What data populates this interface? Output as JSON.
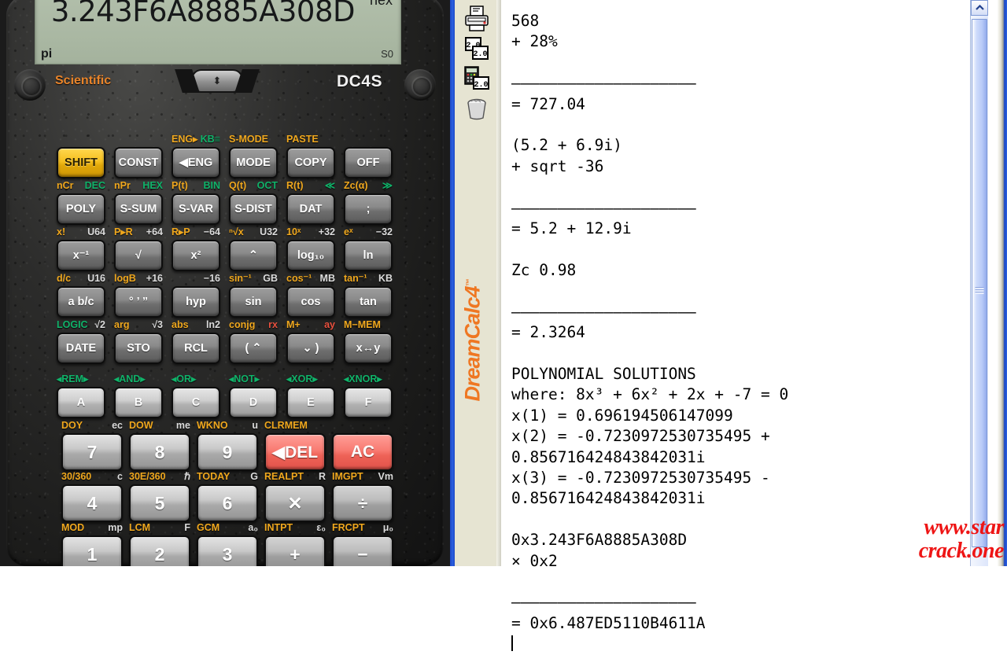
{
  "app": {
    "brand": "DreamCalc",
    "brand_version": "4",
    "brand_tm": "™"
  },
  "display": {
    "value": "3.243F6A8885A308D",
    "base_indicator": "hex",
    "angle_indicator": "pi",
    "memory_indicator": "S0",
    "mode_label": "Scientific",
    "model_label": "DC4S",
    "rocker_glyph": "⬍"
  },
  "keys": {
    "rows": [
      {
        "cells": [
          {
            "top_left": "",
            "top_right": "",
            "face": "SHIFT",
            "style": "shift",
            "name": "shift"
          },
          {
            "top_left": "",
            "top_right": "",
            "face": "CONST",
            "style": "",
            "name": "const"
          },
          {
            "top_left": "ENG▸",
            "tl_color": "y",
            "top_right": "KB≡",
            "tr_color": "g",
            "face": "◀ENG",
            "style": "",
            "name": "eng"
          },
          {
            "top_left": "S-MODE",
            "tl_color": "y",
            "top_right": "",
            "face": "MODE",
            "style": "",
            "name": "mode"
          },
          {
            "top_left": "PASTE",
            "tl_color": "y",
            "top_right": "",
            "face": "COPY",
            "style": "",
            "name": "copy"
          },
          {
            "top_left": "",
            "top_right": "",
            "face": "OFF",
            "style": "",
            "name": "off"
          }
        ]
      },
      {
        "cells": [
          {
            "top_left": "nCr",
            "tl_color": "y",
            "top_right": "DEC",
            "tr_color": "g",
            "face": "POLY",
            "style": "",
            "name": "poly"
          },
          {
            "top_left": "nPr",
            "tl_color": "y",
            "top_right": "HEX",
            "tr_color": "g",
            "face": "S-SUM",
            "style": "",
            "name": "s-sum"
          },
          {
            "top_left": "P(t)",
            "tl_color": "y",
            "top_right": "BIN",
            "tr_color": "g",
            "face": "S-VAR",
            "style": "",
            "name": "s-var"
          },
          {
            "top_left": "Q(t)",
            "tl_color": "y",
            "top_right": "OCT",
            "tr_color": "g",
            "face": "S-DIST",
            "style": "",
            "name": "s-dist"
          },
          {
            "top_left": "R(t)",
            "tl_color": "y",
            "top_right": "≪",
            "tr_color": "g",
            "face": "DAT",
            "style": "",
            "name": "dat"
          },
          {
            "top_left": "Zc(α)",
            "tl_color": "y",
            "top_right": "≫",
            "tr_color": "g",
            "face": ";",
            "style": "",
            "name": "semicolon"
          }
        ]
      },
      {
        "cells": [
          {
            "top_left": "x!",
            "tl_color": "y",
            "top_right": "U64",
            "tr_color": "w",
            "face": "x⁻¹",
            "style": "",
            "name": "reciprocal"
          },
          {
            "top_left": "P▸R",
            "tl_color": "y",
            "top_right": "+64",
            "tr_color": "w",
            "face": "√",
            "style": "",
            "name": "sqrt"
          },
          {
            "top_left": "R▸P",
            "tl_color": "y",
            "top_right": "−64",
            "tr_color": "w",
            "face": "x²",
            "style": "",
            "name": "square"
          },
          {
            "top_left": "ⁿ√x",
            "tl_color": "y",
            "top_right": "U32",
            "tr_color": "w",
            "face": "⌃",
            "style": "",
            "name": "power"
          },
          {
            "top_left": "10ˣ",
            "tl_color": "y",
            "top_right": "+32",
            "tr_color": "w",
            "face": "log₁₀",
            "style": "",
            "name": "log10"
          },
          {
            "top_left": "eˣ",
            "tl_color": "y",
            "top_right": "−32",
            "tr_color": "w",
            "face": "ln",
            "style": "",
            "name": "ln"
          }
        ]
      },
      {
        "cells": [
          {
            "top_left": "d/c",
            "tl_color": "y",
            "top_right": "U16",
            "tr_color": "w",
            "face": "a b/c",
            "style": "",
            "name": "fraction"
          },
          {
            "top_left": "logB",
            "tl_color": "y",
            "top_right": "+16",
            "tr_color": "w",
            "face": "° ’ ”",
            "style": "",
            "name": "dms"
          },
          {
            "top_left": "",
            "top_right": "−16",
            "tr_color": "w",
            "face": "hyp",
            "style": "",
            "name": "hyp"
          },
          {
            "top_left": "sin⁻¹",
            "tl_color": "y",
            "top_right": "GB",
            "tr_color": "w",
            "face": "sin",
            "style": "",
            "name": "sin"
          },
          {
            "top_left": "cos⁻¹",
            "tl_color": "y",
            "top_right": "MB",
            "tr_color": "w",
            "face": "cos",
            "style": "",
            "name": "cos"
          },
          {
            "top_left": "tan⁻¹",
            "tl_color": "y",
            "top_right": "KB",
            "tr_color": "w",
            "face": "tan",
            "style": "",
            "name": "tan"
          }
        ]
      },
      {
        "cells": [
          {
            "top_left": "LOGIC",
            "tl_color": "g",
            "top_right": "√2",
            "tr_color": "w",
            "face": "DATE",
            "style": "",
            "name": "date"
          },
          {
            "top_left": "arg",
            "tl_color": "y",
            "top_right": "√3",
            "tr_color": "w",
            "face": "STO",
            "style": "",
            "name": "sto"
          },
          {
            "top_left": "abs",
            "tl_color": "y",
            "top_right": "ln2",
            "tr_color": "w",
            "face": "RCL",
            "style": "",
            "name": "rcl"
          },
          {
            "top_left": "conjg",
            "tl_color": "y",
            "top_right": "rx",
            "tr_color": "rd",
            "face": "( ⌃",
            "style": "",
            "name": "paren-open"
          },
          {
            "top_left": "M+",
            "tl_color": "y",
            "top_right": "ay",
            "tr_color": "rd",
            "face": "⌄ )",
            "style": "",
            "name": "paren-close"
          },
          {
            "top_left": "M−MEM",
            "tl_color": "y",
            "tr_color": "rd",
            "top_right": "",
            "face": "x↔y",
            "style": "",
            "name": "swap-xy"
          }
        ]
      },
      {
        "cells": [
          {
            "top_left": "◂REM▸",
            "tl_color": "g",
            "top_right": "",
            "face": "A",
            "style": "hexk",
            "name": "hex-a"
          },
          {
            "top_left": "◂AND▸",
            "tl_color": "g",
            "top_right": "",
            "face": "B",
            "style": "hexk",
            "name": "hex-b"
          },
          {
            "top_left": "◂OR▸",
            "tl_color": "g",
            "top_right": "",
            "face": "C",
            "style": "hexk",
            "name": "hex-c"
          },
          {
            "top_left": "◂NOT▸",
            "tl_color": "g",
            "top_right": "",
            "face": "D",
            "style": "hexk",
            "name": "hex-d"
          },
          {
            "top_left": "◂XOR▸",
            "tl_color": "g",
            "top_right": "",
            "face": "E",
            "style": "hexk",
            "name": "hex-e"
          },
          {
            "top_left": "◂XNOR▸",
            "tl_color": "g",
            "top_right": "",
            "face": "F",
            "style": "hexk",
            "name": "hex-f"
          }
        ]
      }
    ],
    "numrows": [
      {
        "cells": [
          {
            "top_left": "DOY",
            "tl_color": "y",
            "top_right": "ec",
            "tr_color": "w",
            "face": "7",
            "style": "num",
            "name": "digit-7"
          },
          {
            "top_left": "DOW",
            "tl_color": "y",
            "top_right": "me",
            "tr_color": "w",
            "face": "8",
            "style": "num",
            "name": "digit-8"
          },
          {
            "top_left": "WKNO",
            "tl_color": "y",
            "top_right": "u",
            "tr_color": "w",
            "face": "9",
            "style": "num",
            "name": "digit-9"
          },
          {
            "top_left": "CLRMEM",
            "tl_color": "y",
            "top_right": "",
            "face": "◀DEL",
            "style": "numred",
            "name": "delete"
          },
          {
            "top_left": "",
            "top_right": "",
            "face": "AC",
            "style": "numred",
            "name": "all-clear"
          }
        ]
      },
      {
        "cells": [
          {
            "top_left": "30/360",
            "tl_color": "y",
            "top_right": "c",
            "tr_color": "w",
            "face": "4",
            "style": "num",
            "name": "digit-4"
          },
          {
            "top_left": "30E/360",
            "tl_color": "y",
            "top_right": "ℏ",
            "tr_color": "w",
            "face": "5",
            "style": "num",
            "name": "digit-5"
          },
          {
            "top_left": "TODAY",
            "tl_color": "y",
            "top_right": "G",
            "tr_color": "w",
            "face": "6",
            "style": "num",
            "name": "digit-6"
          },
          {
            "top_left": "REALPT",
            "tl_color": "y",
            "top_right": "R",
            "tr_color": "w",
            "face": "✕",
            "style": "op",
            "name": "multiply"
          },
          {
            "top_left": "IMGPT",
            "tl_color": "y",
            "top_right": "Vm",
            "tr_color": "w",
            "face": "÷",
            "style": "op",
            "name": "divide"
          }
        ]
      },
      {
        "cells": [
          {
            "top_left": "MOD",
            "tl_color": "y",
            "top_right": "mp",
            "tr_color": "w",
            "face": "1",
            "style": "num",
            "name": "digit-1"
          },
          {
            "top_left": "LCM",
            "tl_color": "y",
            "top_right": "F",
            "tr_color": "w",
            "face": "2",
            "style": "num",
            "name": "digit-2"
          },
          {
            "top_left": "GCM",
            "tl_color": "y",
            "top_right": "a₀",
            "tr_color": "w",
            "face": "3",
            "style": "num",
            "name": "digit-3"
          },
          {
            "top_left": "INTPT",
            "tl_color": "y",
            "top_right": "ε₀",
            "tr_color": "w",
            "face": "+",
            "style": "op",
            "name": "plus"
          },
          {
            "top_left": "FRCPT",
            "tl_color": "y",
            "top_right": "μ₀",
            "tr_color": "w",
            "face": "−",
            "style": "op",
            "name": "minus"
          }
        ]
      }
    ]
  },
  "toolbar": {
    "items": [
      {
        "name": "print-icon",
        "label": "Print"
      },
      {
        "name": "copy-icon",
        "label": "Copy"
      },
      {
        "name": "paste-to-calculator-icon",
        "label": "Paste"
      },
      {
        "name": "delete-icon",
        "label": "Clear"
      }
    ]
  },
  "tape": {
    "text": "568\n+ 28%\n\n————————————————————\n= 727.04\n\n(5.2 + 6.9i)\n+ sqrt -36\n\n————————————————————\n= 5.2 + 12.9i\n\nZc 0.98\n\n————————————————————\n= 2.3264\n\nPOLYNOMIAL SOLUTIONS\nwhere: 8x³ + 6x² + 2x + -7 = 0\nx(1) = 0.696194506147099\nx(2) = -0.7230972530735495 +\n0.856716424843842031i\nx(3) = -0.7230972530735495 -\n0.856716424843842031i\n\n0x3.243F6A8885A308D\n× 0x2\n\n————————————————————\n= 0x6.487ED5110B4611A\n",
    "entries": [
      {
        "input": [
          "568",
          "+ 28%"
        ],
        "result": "= 727.04"
      },
      {
        "input": [
          "(5.2 + 6.9i)",
          "+ sqrt -36"
        ],
        "result": "= 5.2 + 12.9i"
      },
      {
        "input": [
          "Zc 0.98"
        ],
        "result": "= 2.3264"
      },
      {
        "input": [
          "POLYNOMIAL SOLUTIONS",
          "where: 8x³ + 6x² + 2x + -7 = 0",
          "x(1) = 0.696194506147099",
          "x(2) = -0.7230972530735495 +",
          "0.856716424843842031i",
          "x(3) = -0.7230972530735495 -",
          "0.856716424843842031i"
        ],
        "result": ""
      },
      {
        "input": [
          "0x3.243F6A8885A308D",
          "× 0x2"
        ],
        "result": "= 0x6.487ED5110B4611A"
      }
    ]
  },
  "scrollbar": {
    "up_arrow": "︿"
  },
  "watermark": {
    "line1": "www.star",
    "line2": "crack.one"
  },
  "colors": {
    "accent_orange": "#ef7722",
    "key_yellow": "#f0a81e",
    "key_green": "#10b36a",
    "key_red": "#e2534a",
    "lcd_green": "#aab8a3",
    "watermark_red": "#ee1515"
  }
}
